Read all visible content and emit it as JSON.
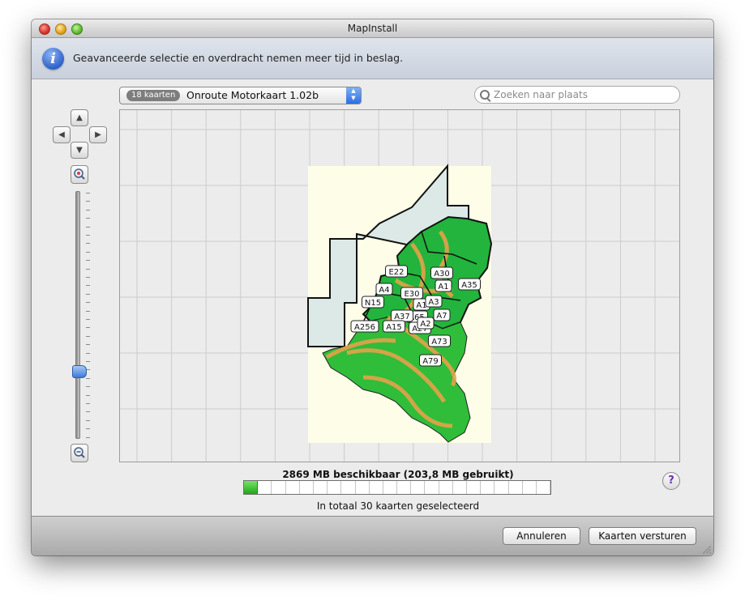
{
  "window": {
    "title": "MapInstall"
  },
  "info": {
    "message": "Geavanceerde selectie en overdracht nemen meer tijd in beslag."
  },
  "map_select": {
    "badge": "18 kaarten",
    "selected": "Onroute Motorkaart 1.02b"
  },
  "search": {
    "placeholder": "Zoeken naar plaats",
    "value": ""
  },
  "nav": {
    "up": "▲",
    "left": "◀",
    "right": "▶",
    "down": "▼"
  },
  "zoom": {
    "level_fraction": 0.27
  },
  "map": {
    "road_labels": [
      "E22",
      "A30",
      "A1",
      "A35",
      "A4",
      "E30",
      "N15",
      "A1",
      "A3",
      "A7",
      "A65",
      "A37",
      "A256",
      "A15",
      "A27",
      "A2",
      "A73",
      "A79"
    ],
    "colors": {
      "background": "#fdfde8",
      "region": "#22b43c",
      "roads": "#e6a24a",
      "sea": "#dde9e6",
      "grid": "#cccccc"
    }
  },
  "storage": {
    "label": "2869 MB beschikbaar (203,8 MB gebruikt)",
    "used_fraction": 0.066
  },
  "selection": {
    "count_text": "In totaal 30 kaarten geselecteerd"
  },
  "help": {
    "label": "?"
  },
  "buttons": {
    "cancel": "Annuleren",
    "send": "Kaarten versturen"
  },
  "icons": [
    "info-icon",
    "search-icon",
    "zoom-in-icon",
    "zoom-out-icon",
    "help-icon",
    "resize-grip-icon"
  ]
}
